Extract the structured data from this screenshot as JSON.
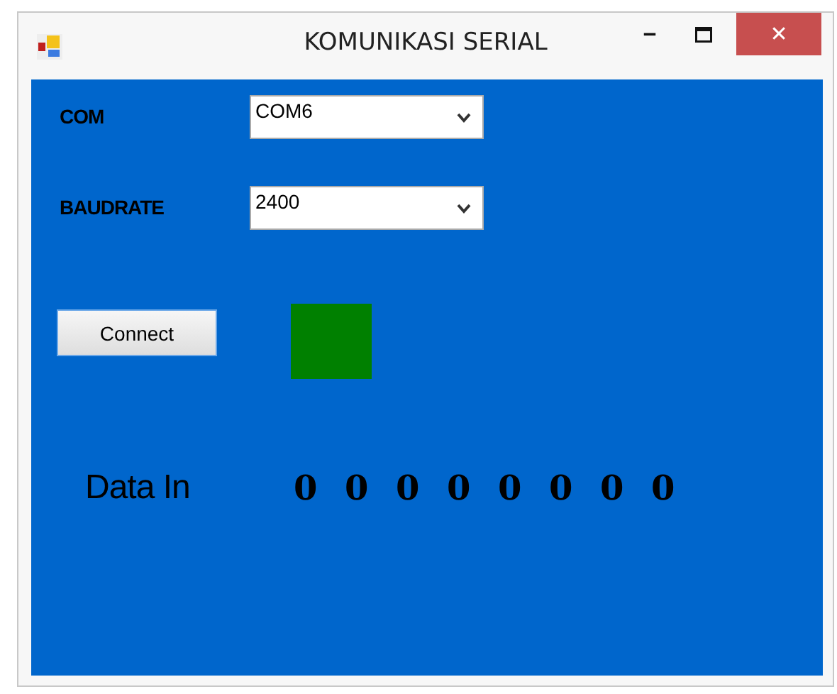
{
  "window": {
    "title": "KOMUNIKASI SERIAL",
    "controls": {
      "minimize": "‒",
      "close": "✕"
    }
  },
  "fields": [
    {
      "label": "COM",
      "value": "COM6"
    },
    {
      "label": "BAUDRATE",
      "value": "2400"
    }
  ],
  "connect_button": "Connect",
  "indicator": {
    "color": "#008000"
  },
  "data_in": {
    "label": "Data In",
    "bits": [
      "0",
      "0",
      "0",
      "0",
      "0",
      "0",
      "0",
      "0"
    ]
  }
}
